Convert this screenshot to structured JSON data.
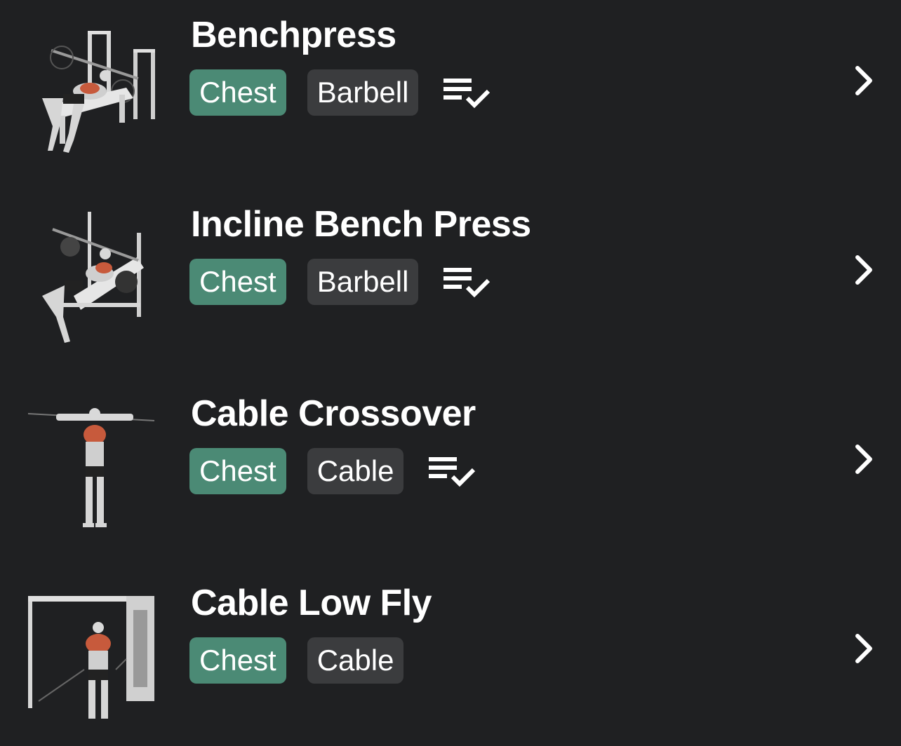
{
  "exercises": [
    {
      "name": "Benchpress",
      "muscle": "Chest",
      "equipment": "Barbell",
      "has_log": true
    },
    {
      "name": "Incline Bench Press",
      "muscle": "Chest",
      "equipment": "Barbell",
      "has_log": true
    },
    {
      "name": "Cable Crossover",
      "muscle": "Chest",
      "equipment": "Cable",
      "has_log": true
    },
    {
      "name": "Cable Low Fly",
      "muscle": "Chest",
      "equipment": "Cable",
      "has_log": false
    }
  ],
  "colors": {
    "background": "#1f2022",
    "muscle_tag": "#4b8a75",
    "equipment_tag": "#3b3c3e",
    "text": "#ffffff"
  },
  "icons": {
    "log": "playlist-check-icon",
    "chevron": "chevron-right-icon"
  }
}
